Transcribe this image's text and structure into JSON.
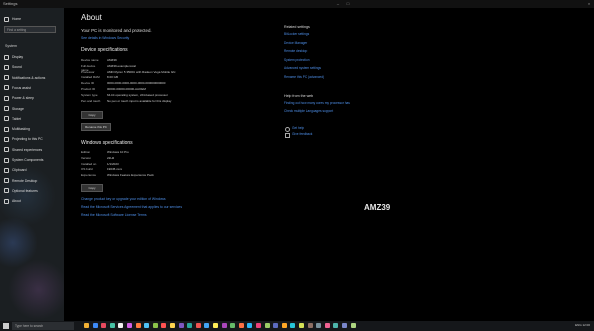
{
  "window": {
    "title": "Settings",
    "min": "–",
    "max": "□",
    "close": "×"
  },
  "sidebar": {
    "home": "Home",
    "search_placeholder": "Find a setting",
    "section": "System",
    "items": [
      {
        "label": "Display",
        "icon": "display-icon"
      },
      {
        "label": "Sound",
        "icon": "sound-icon"
      },
      {
        "label": "Notifications & actions",
        "icon": "notifications-icon"
      },
      {
        "label": "Focus assist",
        "icon": "focus-icon"
      },
      {
        "label": "Power & sleep",
        "icon": "power-icon"
      },
      {
        "label": "Storage",
        "icon": "storage-icon"
      },
      {
        "label": "Tablet",
        "icon": "tablet-icon"
      },
      {
        "label": "Multitasking",
        "icon": "multitasking-icon"
      },
      {
        "label": "Projecting to this PC",
        "icon": "projecting-icon"
      },
      {
        "label": "Shared experiences",
        "icon": "shared-icon"
      },
      {
        "label": "System Components",
        "icon": "components-icon"
      },
      {
        "label": "Clipboard",
        "icon": "clipboard-icon"
      },
      {
        "label": "Remote Desktop",
        "icon": "remote-icon"
      },
      {
        "label": "Optional features",
        "icon": "optional-icon"
      },
      {
        "label": "About",
        "icon": "about-icon"
      }
    ]
  },
  "main": {
    "title": "About",
    "protect_text": "Your PC is monitored and protected.",
    "protect_link": "See details in Windows Security",
    "device_heading": "Device specifications",
    "device_specs": [
      {
        "k": "Device name",
        "v": "AMZ39"
      },
      {
        "k": "Full device name",
        "v": "AMZ39.example.local"
      },
      {
        "k": "Processor",
        "v": "AMD Ryzen 5 3500U with Radeon Vega Mobile Gfx"
      },
      {
        "k": "Installed RAM",
        "v": "8.00 GB"
      },
      {
        "k": "Device ID",
        "v": "0000-0000-0000-0000-0000-000000000000"
      },
      {
        "k": "Product ID",
        "v": "00000-00000-00000-AAOEM"
      },
      {
        "k": "System type",
        "v": "64-bit operating system, x64-based processor"
      },
      {
        "k": "Pen and touch",
        "v": "No pen or touch input is available for this display"
      }
    ],
    "copy_label": "Copy",
    "rename_label": "Rename this PC",
    "windows_heading": "Windows specifications",
    "windows_specs": [
      {
        "k": "Edition",
        "v": "Windows 10 Pro"
      },
      {
        "k": "Version",
        "v": "22H2"
      },
      {
        "k": "Installed on",
        "v": "1/1/2023"
      },
      {
        "k": "OS build",
        "v": "19045.xxxx"
      },
      {
        "k": "Experience",
        "v": "Windows Feature Experience Pack"
      }
    ],
    "copy2_label": "Copy",
    "links": [
      "Change product key or upgrade your edition of Windows",
      "Read the Microsoft Services Agreement that applies to our services",
      "Read the Microsoft Software License Terms"
    ]
  },
  "right": {
    "related_heading": "Related settings",
    "related_links": [
      "BitLocker settings",
      "Device Manager",
      "Remote desktop",
      "System protection",
      "Advanced system settings",
      "Rename this PC (advanced)"
    ],
    "help_heading": "Help from the web",
    "help_links": [
      "Finding out how many cores my processor has",
      "Check multiple Languages support"
    ],
    "get_help": "Get help",
    "give_feedback": "Give feedback"
  },
  "watermark": "AMZ39",
  "taskbar": {
    "search_placeholder": "Type here to search",
    "tray_text": "ENG 12:00"
  }
}
